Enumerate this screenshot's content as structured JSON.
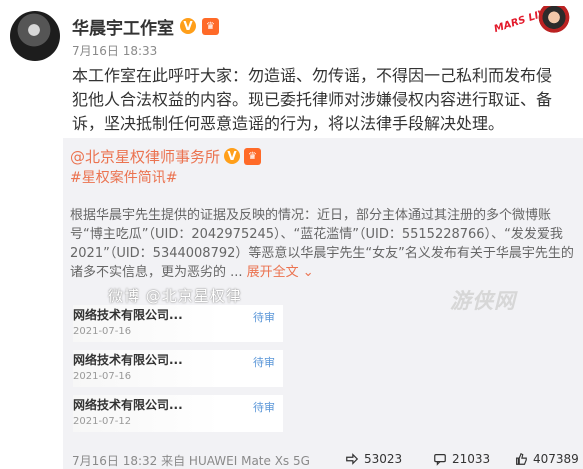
{
  "post": {
    "author": "华晨宇工作室",
    "time": "7月16日 18:33",
    "content": "本工作室在此呼吁大家：勿造谣、勿传谣，不得因一己私利而发布侵犯他人合法权益的内容。现已委托律师对涉嫌侵权内容进行取证、备诉，坚决抵制任何恶意造谣的行为，将以法律手段解决处理。",
    "corner_logo_text": "MARS LIVE"
  },
  "repost": {
    "author": "@北京星权律师事务所",
    "hashtag": "#星权案件简讯#",
    "text": "根据华晨宇先生提供的证据及反映的情况：近日，部分主体通过其注册的多个微博账号“博主吃瓜”（UID：2042975245）、“蓝花滥情”（UID：5515228766）、“发发爱我2021”（UID：5344008792）等恶意以华晨宇先生“女友”名义发布有关于华晨宇先生的诸多不实信息，更为恶劣的 ...",
    "expand_label": "展开全文 ⌄",
    "thumbs": [
      {
        "title": "网络技术有限公司...",
        "date": "2021-07-16",
        "tag": "待审"
      },
      {
        "title": "网络技术有限公司...",
        "date": "2021-07-16",
        "tag": "待审"
      },
      {
        "title": "网络技术有限公司...",
        "date": "2021-07-12",
        "tag": "待审"
      }
    ],
    "watermark": "微博 @北京星权律",
    "site_watermark": "游侠网"
  },
  "footer": {
    "meta": "7月16日 18:32 来自 HUAWEI Mate Xs 5G",
    "forward_count": "53023",
    "comment_count": "21033",
    "like_count": "407389"
  },
  "colors": {
    "accent": "#eb7350",
    "verified": "#ff9f1a",
    "repost_bg": "#f2f2f5",
    "meta": "#8a8a8a"
  }
}
